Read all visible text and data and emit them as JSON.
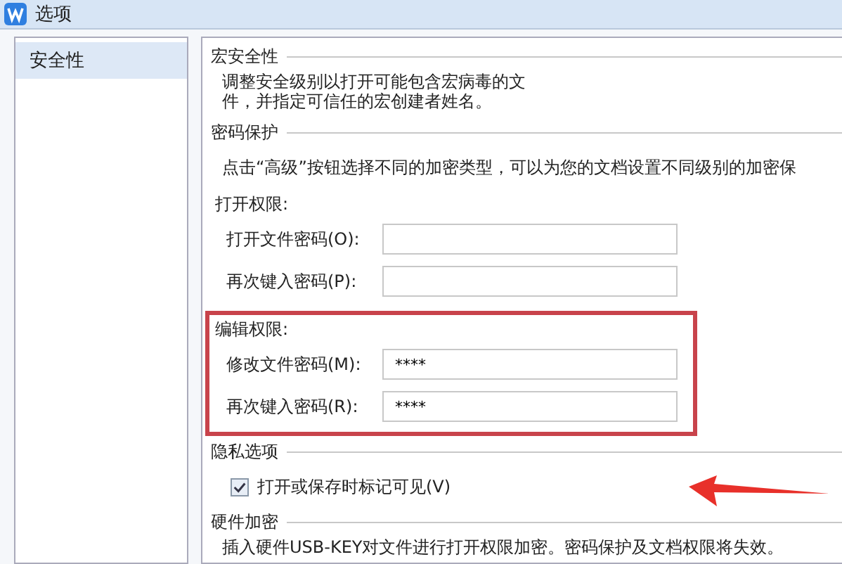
{
  "window": {
    "title": "选项"
  },
  "sidebar": {
    "items": [
      {
        "label": "安全性",
        "selected": true
      }
    ]
  },
  "macro_security": {
    "heading": "宏安全性",
    "description": [
      "调整安全级别以打开可能包含宏病毒的文",
      "件，并指定可信任的宏创建者姓名。"
    ]
  },
  "password_protection": {
    "heading": "密码保护",
    "description": "点击“高级”按钮选择不同的加密类型，可以为您的文档设置不同级别的加密保",
    "groups": [
      {
        "title": "打开权限:",
        "highlighted": false,
        "fields": [
          {
            "label": "打开文件密码(O):"
          },
          {
            "label": "再次键入密码(P):"
          }
        ]
      },
      {
        "title": "编辑权限:",
        "highlighted": true,
        "fields": [
          {
            "label": "修改文件密码(M):",
            "value": "****"
          },
          {
            "label": "再次键入密码(R):",
            "value": "****"
          }
        ]
      }
    ]
  },
  "privacy": {
    "heading": "隐私选项",
    "checkbox": {
      "label": "打开或保存时标记可见(V)",
      "checked": true
    }
  },
  "hardware": {
    "heading": "硬件加密",
    "description": "插入硬件USB-KEY对文件进行打开权限加密。密码保护及文档权限将失效。"
  }
}
